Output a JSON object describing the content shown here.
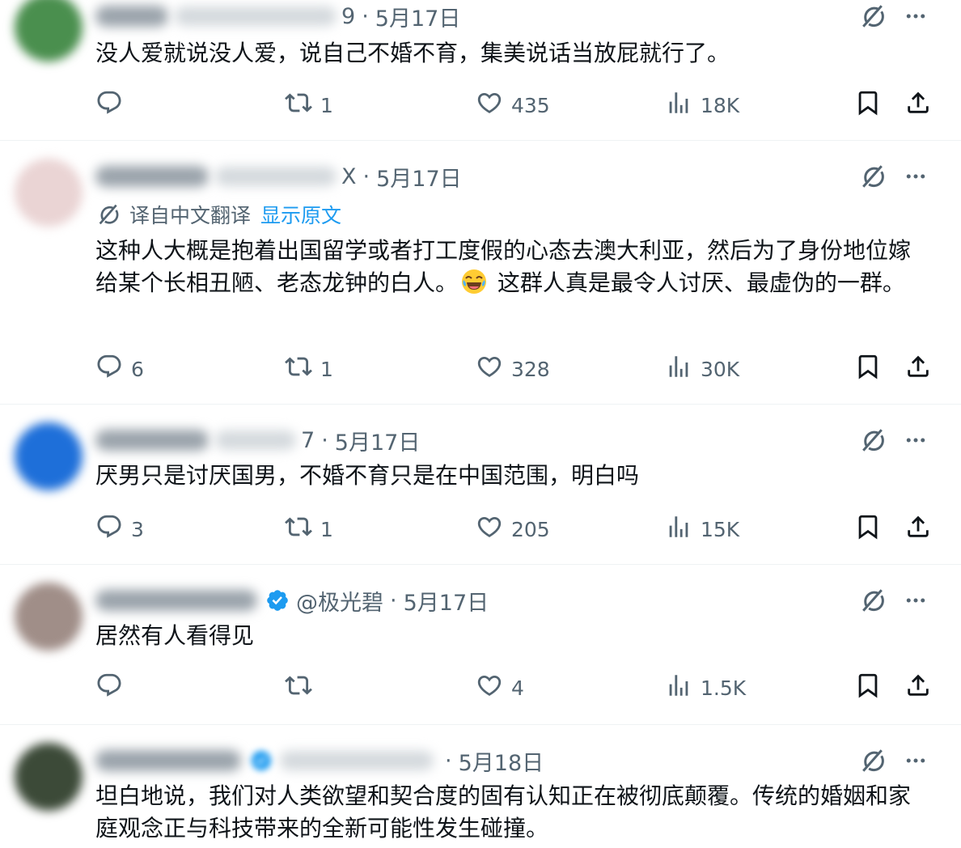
{
  "tweets": [
    {
      "handle_tail": "9",
      "date": "5月17日",
      "verified": false,
      "translation": null,
      "text": "没人爱就说没人爱，说自己不婚不育，集美说话当放屁就行了。",
      "replies": "",
      "retweets": "1",
      "likes": "435",
      "views": "18K",
      "avatar_color": "#4a8f4e"
    },
    {
      "handle_tail": "X",
      "date": "5月17日",
      "verified": false,
      "translation": {
        "label": "译自中文翻译",
        "link": "显示原文"
      },
      "text": "这种人大概是抱着出国留学或者打工度假的心态去澳大利亚，然后为了身份地位嫁给某个长相丑陋、老态龙钟的白人。",
      "text_after_emoji": " 这群人真是最令人讨厌、最虚伪的一群。",
      "emoji": "face-with-tears-of-joy",
      "replies": "6",
      "retweets": "1",
      "likes": "328",
      "views": "30K",
      "avatar_color": "#e6c7c7"
    },
    {
      "handle_tail": "7",
      "date": "5月17日",
      "verified": false,
      "translation": null,
      "text": "厌男只是讨厌国男，不婚不育只是在中国范围，明白吗",
      "replies": "3",
      "retweets": "1",
      "likes": "205",
      "views": "15K",
      "avatar_color": "#1e6fd9"
    },
    {
      "handle_tail": "@极光碧",
      "date": "5月17日",
      "verified": true,
      "translation": null,
      "text": "居然有人看得见",
      "replies": "",
      "retweets": "",
      "likes": "4",
      "views": "1.5K",
      "avatar_color": "#a08e88"
    },
    {
      "handle_tail": "",
      "date": "5月18日",
      "verified": true,
      "translation": null,
      "text": "坦白地说，我们对人类欲望和契合度的固有认知正在被彻底颠覆。传统的婚姻和家庭观念正与科技带来的全新可能性发生碰撞。",
      "replies": "",
      "retweets": "",
      "likes": "",
      "views": "",
      "avatar_color": "#3c4a38"
    }
  ],
  "colors": {
    "secondary": "#536471",
    "link": "#1d9bf0",
    "text": "#0f1419",
    "verified": "#1d9bf0"
  },
  "icons": [
    "reply-icon",
    "retweet-icon",
    "like-icon",
    "views-icon",
    "bookmark-icon",
    "share-icon",
    "grok-icon",
    "more-icon",
    "translate-icon",
    "verified-icon"
  ]
}
